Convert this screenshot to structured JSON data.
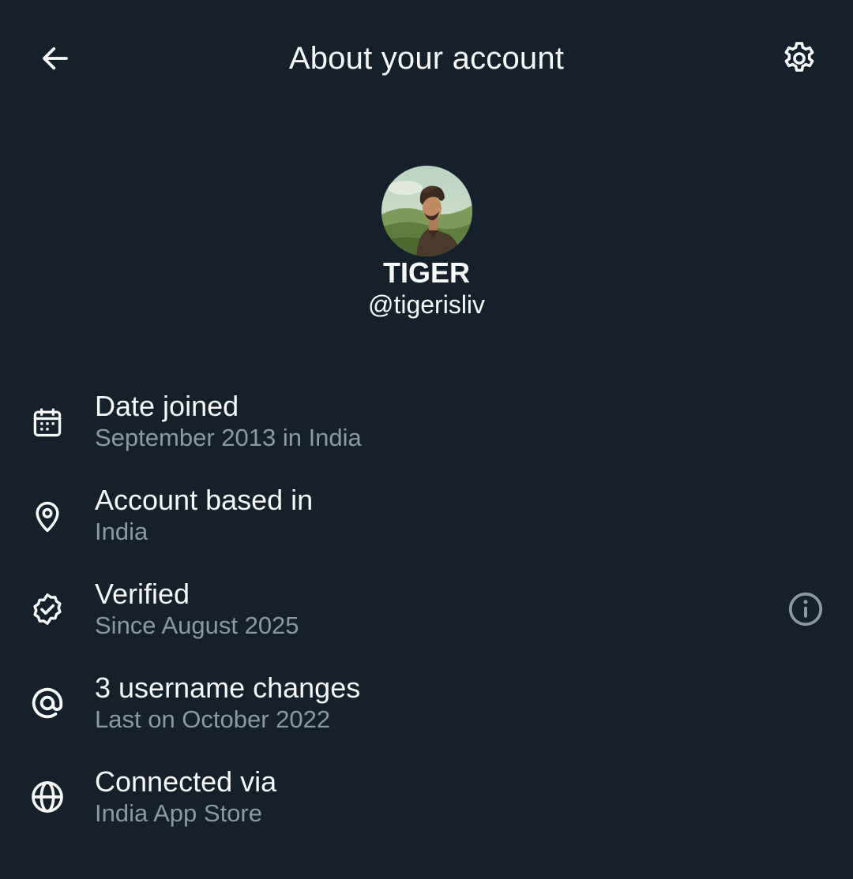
{
  "header": {
    "title": "About your account",
    "back_icon": "arrow-left-icon",
    "settings_icon": "gear-icon"
  },
  "profile": {
    "display_name": "TIGER",
    "username": "@tigerisliv",
    "avatar_icon": "avatar-illustration"
  },
  "details": [
    {
      "icon": "calendar-icon",
      "label": "Date joined",
      "value": "September 2013 in India"
    },
    {
      "icon": "location-pin-icon",
      "label": "Account based in",
      "value": "India"
    },
    {
      "icon": "verified-badge-icon",
      "label": "Verified",
      "value": "Since August 2025",
      "action_icon": "info-icon"
    },
    {
      "icon": "at-sign-icon",
      "label": "3 username changes",
      "value": "Last on October 2022"
    },
    {
      "icon": "globe-icon",
      "label": "Connected via",
      "value": "India App Store"
    }
  ],
  "colors": {
    "background": "#15202b",
    "primary_text": "#f7f9f9",
    "secondary_text": "#8b98a5"
  }
}
